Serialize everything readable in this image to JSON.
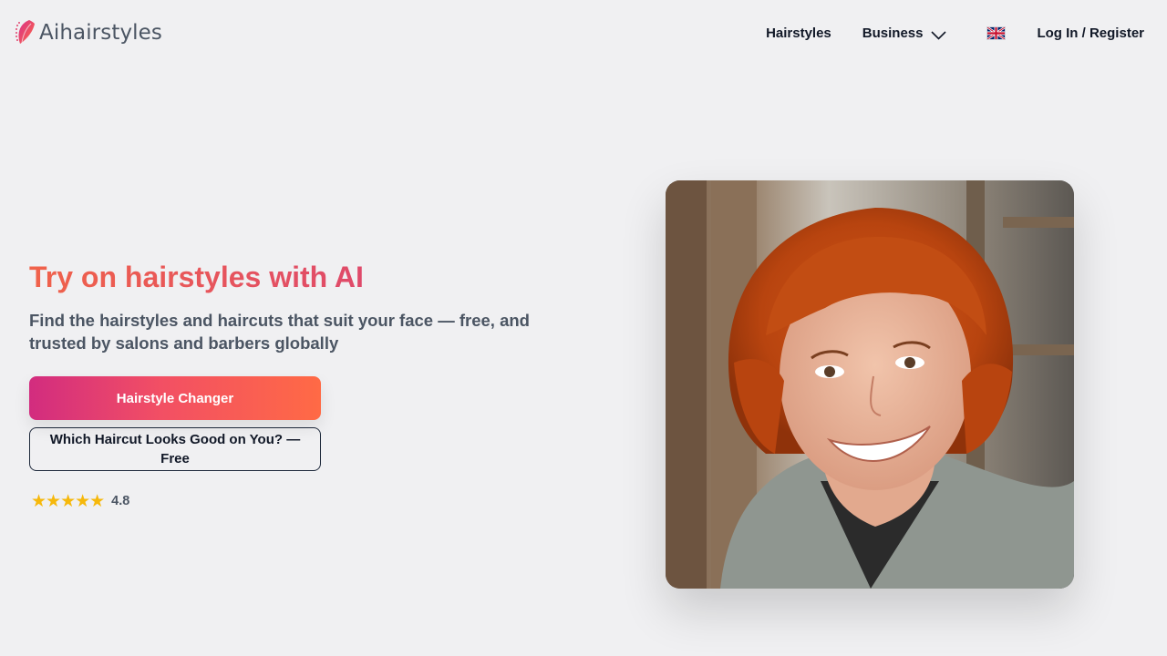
{
  "brand": {
    "name": "Aihairstyles",
    "logo_icon": "leaf-hair-logo-icon"
  },
  "nav": {
    "hairstyles": "Hairstyles",
    "business": "Business",
    "business_icon": "chevron-down-icon",
    "language_icon": "uk-flag-icon",
    "login": "Log In / Register"
  },
  "hero": {
    "title": "Try on hairstyles with AI",
    "subtitle": "Find the hairstyles and haircuts that suit your face — free, and trusted by salons and barbers globally",
    "primary_button": "Hairstyle Changer",
    "secondary_button": "Which Haircut Looks Good on You? — Free",
    "stars": "★★★★★",
    "rating": "4.8",
    "rating_value": 4.8,
    "image_icon": "woman-red-bob-haircut-photo"
  },
  "colors": {
    "background": "#f0f0f2",
    "accent_start": "#d22c7f",
    "accent_end": "#ff6a45",
    "star": "#f6b80b",
    "text_dark": "#111827"
  }
}
